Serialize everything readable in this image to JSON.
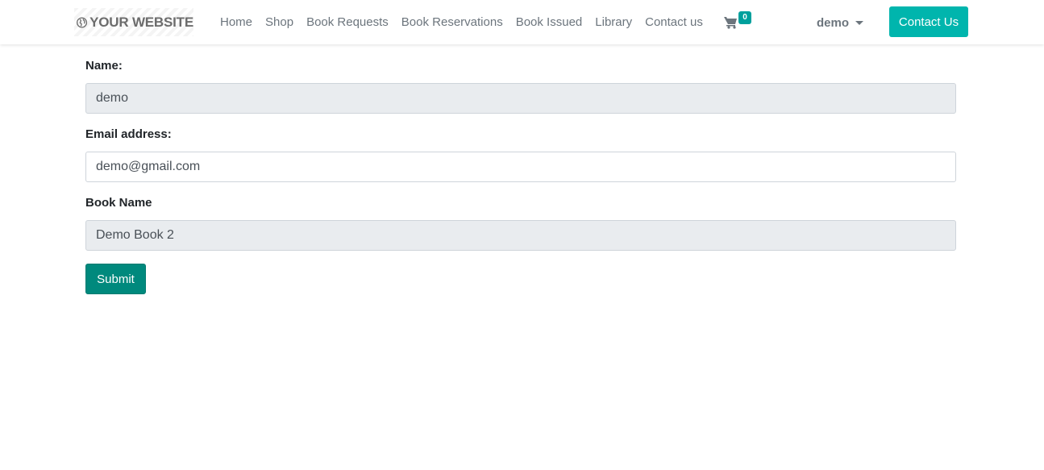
{
  "navbar": {
    "logo_text": "YOUR WEBSITE",
    "links": [
      "Home",
      "Shop",
      "Book Requests",
      "Book Reservations",
      "Book Issued",
      "Library",
      "Contact us"
    ],
    "cart_count": "0",
    "user_name": "demo",
    "contact_button": "Contact Us"
  },
  "form": {
    "name_label": "Name:",
    "name_value": "demo",
    "email_label": "Email address:",
    "email_value": "demo@gmail.com",
    "book_label": "Book Name",
    "book_value": "Demo Book 2",
    "submit_label": "Submit"
  },
  "icons": {
    "logo": "globe-icon",
    "cart": "shopping-cart-icon",
    "user_menu": "caret-down-icon"
  },
  "colors": {
    "accent": "#00b5ad",
    "submit": "#00897d",
    "readonly_bg": "#e9ecef",
    "nav_text": "#6c757d"
  }
}
